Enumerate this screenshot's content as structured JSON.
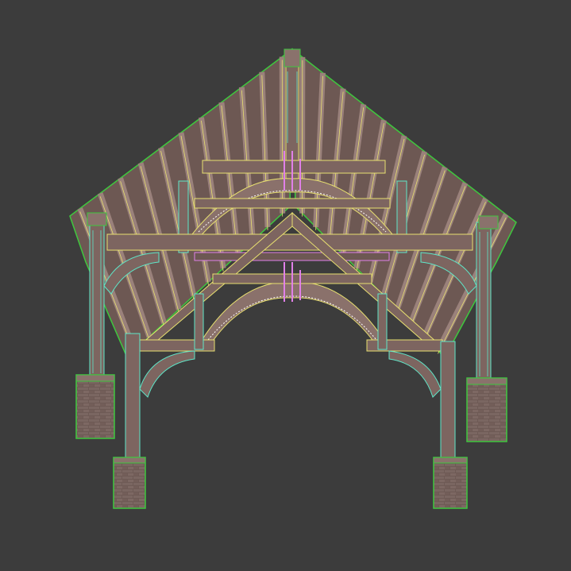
{
  "scene": {
    "subject": "timber-frame-gazebo-wireframe-render",
    "colors": {
      "background": "#3c3c3c",
      "timber": "#7d6560",
      "timber_dark": "#5a4744",
      "timber_light": "#9a817b",
      "wire_green": "#3ec83e",
      "wire_cyan": "#5fe6c8",
      "wire_yellow": "#e8e070",
      "wire_pink": "#e080e8",
      "brick": "#6e5a55",
      "brick_mortar": "#5a4a46"
    },
    "icons": {
      "ridge": "ridge-beam",
      "pier": "brick-pier",
      "arch": "arched-brace",
      "rafter": "rafter"
    }
  }
}
